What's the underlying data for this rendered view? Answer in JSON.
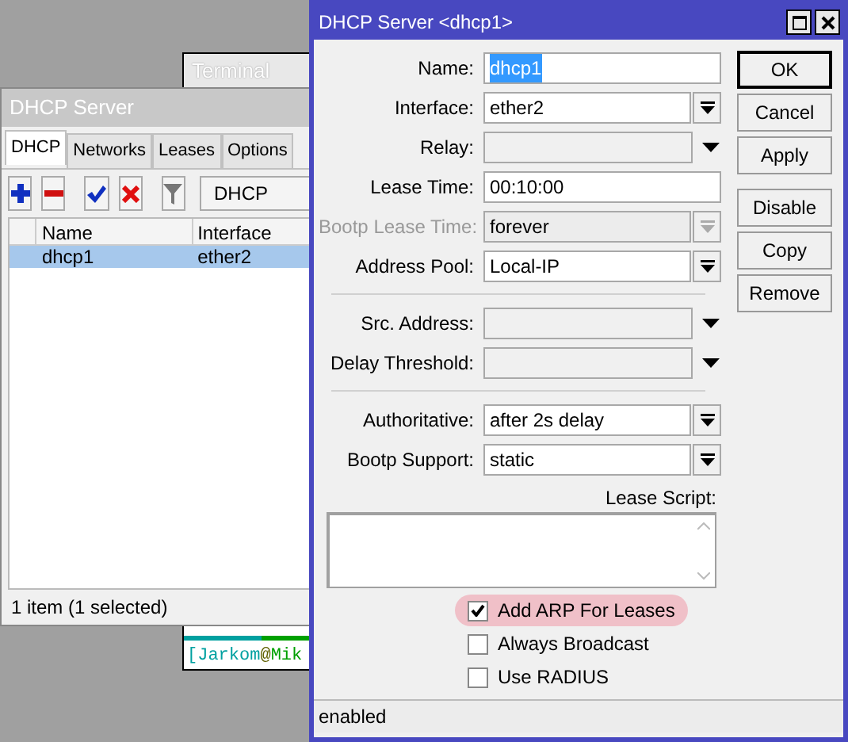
{
  "terminal": {
    "title": "Terminal",
    "prompt": [
      {
        "text": "[",
        "color": "#00a0a0"
      },
      {
        "text": "Jarkom",
        "color": "#00a0a0"
      },
      {
        "text": "@",
        "color": "#606000"
      },
      {
        "text": "Mik",
        "color": "#00a000"
      }
    ]
  },
  "dhcp_window": {
    "title": "DHCP Server",
    "tabs": [
      {
        "label": "DHCP",
        "selected": true
      },
      {
        "label": "Networks",
        "selected": false
      },
      {
        "label": "Leases",
        "selected": false
      },
      {
        "label": "Options",
        "selected": false
      }
    ],
    "toolbar_button": "DHCP",
    "columns": [
      "Name",
      "Interface"
    ],
    "rows": [
      {
        "cells": [
          "dhcp1",
          "ether2"
        ],
        "selected": true
      }
    ],
    "status": "1 item (1 selected)"
  },
  "dialog": {
    "title": "DHCP Server <dhcp1>",
    "rows": [
      {
        "kind": "text",
        "label": "Name:",
        "value": "dhcp1",
        "disabled": false,
        "text_selected": true
      },
      {
        "kind": "select",
        "label": "Interface:",
        "value": "ether2",
        "disabled": false,
        "text_selected": false
      },
      {
        "kind": "combo",
        "label": "Relay:",
        "disabled": false
      },
      {
        "kind": "text",
        "label": "Lease Time:",
        "value": "00:10:00",
        "disabled": false,
        "text_selected": false
      },
      {
        "kind": "select",
        "label": "Bootp Lease Time:",
        "value": "forever",
        "disabled": true,
        "text_selected": false
      },
      {
        "kind": "select",
        "label": "Address Pool:",
        "value": "Local-IP",
        "disabled": false,
        "text_selected": false
      },
      {
        "kind": "separator"
      },
      {
        "kind": "combo",
        "label": "Src. Address:",
        "disabled": false
      },
      {
        "kind": "combo",
        "label": "Delay Threshold:",
        "disabled": false
      },
      {
        "kind": "separator"
      },
      {
        "kind": "select",
        "label": "Authoritative:",
        "value": "after 2s delay",
        "disabled": false,
        "text_selected": false
      },
      {
        "kind": "select",
        "label": "Bootp Support:",
        "value": "static",
        "disabled": false,
        "text_selected": false
      }
    ],
    "lease_script_label": "Lease Script:",
    "checkboxes": [
      {
        "label": "Add ARP For Leases",
        "checked": true,
        "highlighted": true
      },
      {
        "label": "Always Broadcast",
        "checked": false,
        "highlighted": false
      },
      {
        "label": "Use RADIUS",
        "checked": false,
        "highlighted": false
      }
    ],
    "buttons": [
      {
        "label": "OK",
        "default": true
      },
      {
        "label": "Cancel",
        "default": false
      },
      {
        "label": "Apply",
        "default": false
      },
      {
        "label": "Disable",
        "default": false
      },
      {
        "label": "Copy",
        "default": false
      },
      {
        "label": "Remove",
        "default": false
      }
    ],
    "status": "enabled"
  }
}
